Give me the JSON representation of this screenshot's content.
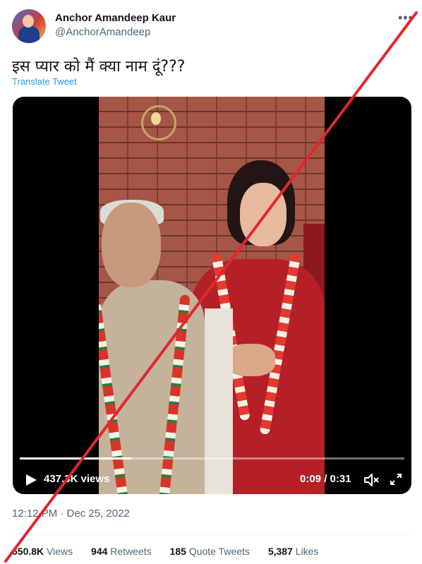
{
  "author": {
    "name": "Anchor Amandeep Kaur",
    "handle": "@AnchorAmandeep"
  },
  "tweet": {
    "text": "इस प्यार को मैं क्या नाम दूं???",
    "translate_label": "Translate Tweet"
  },
  "video": {
    "views_label": "437.3K views",
    "current_time": "0:09",
    "duration": "0:31",
    "progress_fraction": 0.29
  },
  "timestamp": "12:12 PM · Dec 25, 2022",
  "stats": {
    "views_count": "650.8K",
    "views_label": "Views",
    "retweets_count": "944",
    "retweets_label": "Retweets",
    "quotes_count": "185",
    "quotes_label": "Quote Tweets",
    "likes_count": "5,387",
    "likes_label": "Likes"
  },
  "icons": {
    "more": "more-icon",
    "play": "play-icon",
    "volume": "volume-icon",
    "fullscreen": "fullscreen-icon"
  },
  "colors": {
    "link": "#1d9bf0",
    "strike": "#e3262f",
    "secondary_text": "#536471"
  }
}
